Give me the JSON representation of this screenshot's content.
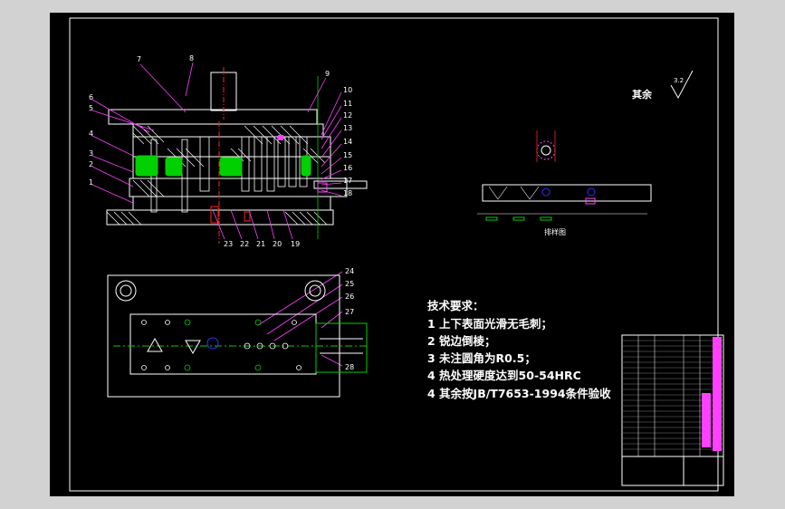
{
  "drawing": {
    "background": "#000000",
    "workspace": "#d2d2d2",
    "frame_color": "#ffffff",
    "colors": {
      "outline": "#ffffff",
      "hatch": "#ffffff",
      "center": "#ff2020",
      "leader": "#ff40ff",
      "part": "#00d000",
      "hole": "#3030ff",
      "highlight": "#ff40ff"
    }
  },
  "labels": {
    "top_left": [
      "7",
      "8",
      "6",
      "5",
      "4",
      "3",
      "2",
      "1"
    ],
    "top_right": [
      "9",
      "10",
      "11",
      "12",
      "13",
      "14",
      "15",
      "16",
      "17",
      "18"
    ],
    "bottom": [
      "23",
      "22",
      "21",
      "20",
      "19"
    ],
    "plan": [
      "24",
      "25",
      "26",
      "27",
      "28"
    ]
  },
  "misc": {
    "other": "其余",
    "roughness": "3.2"
  },
  "strip_layout": {
    "title": "排样图"
  },
  "requirements": {
    "title": "技术要求：",
    "items": [
      "1 上下表面光滑无毛刺；",
      "2 锐边倒棱；",
      "3 未注圆角为R0.5；",
      "4 热处理硬度达到50-54HRC",
      "4 其余按JB/T7653-1994条件验收"
    ]
  }
}
